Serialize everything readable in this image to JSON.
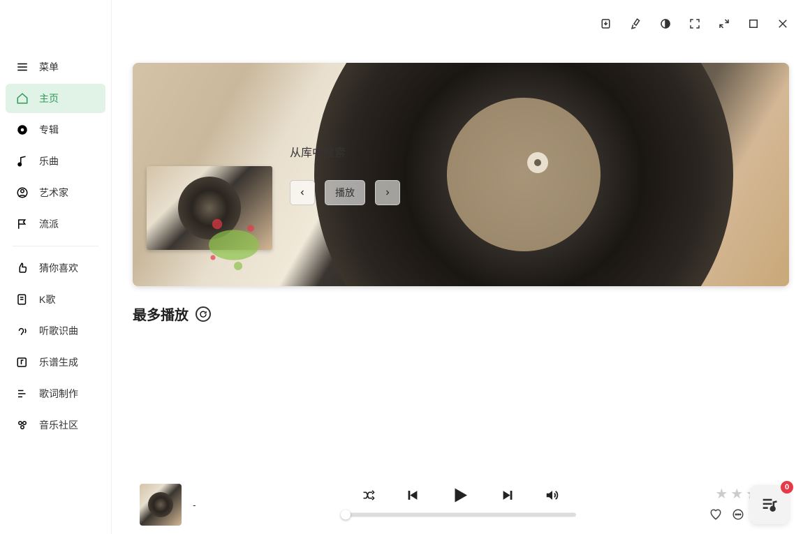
{
  "sidebar": {
    "items": [
      {
        "label": "菜单",
        "icon": "menu"
      },
      {
        "label": "主页",
        "icon": "home",
        "active": true
      },
      {
        "label": "专辑",
        "icon": "disc"
      },
      {
        "label": "乐曲",
        "icon": "note"
      },
      {
        "label": "艺术家",
        "icon": "person"
      },
      {
        "label": "流派",
        "icon": "flag"
      },
      {
        "label": "猜你喜欢",
        "icon": "suggest"
      },
      {
        "label": "K歌",
        "icon": "lyrics-sheet"
      },
      {
        "label": "听歌识曲",
        "icon": "identify"
      },
      {
        "label": "乐谱生成",
        "icon": "score"
      },
      {
        "label": "歌词制作",
        "icon": "lyrics-edit"
      },
      {
        "label": "音乐社区",
        "icon": "community"
      }
    ]
  },
  "hero": {
    "title": "从库中搜索",
    "play_label": "播放"
  },
  "section": {
    "most_played_title": "最多播放"
  },
  "player": {
    "track_title": "-"
  },
  "fab": {
    "badge": "0"
  }
}
